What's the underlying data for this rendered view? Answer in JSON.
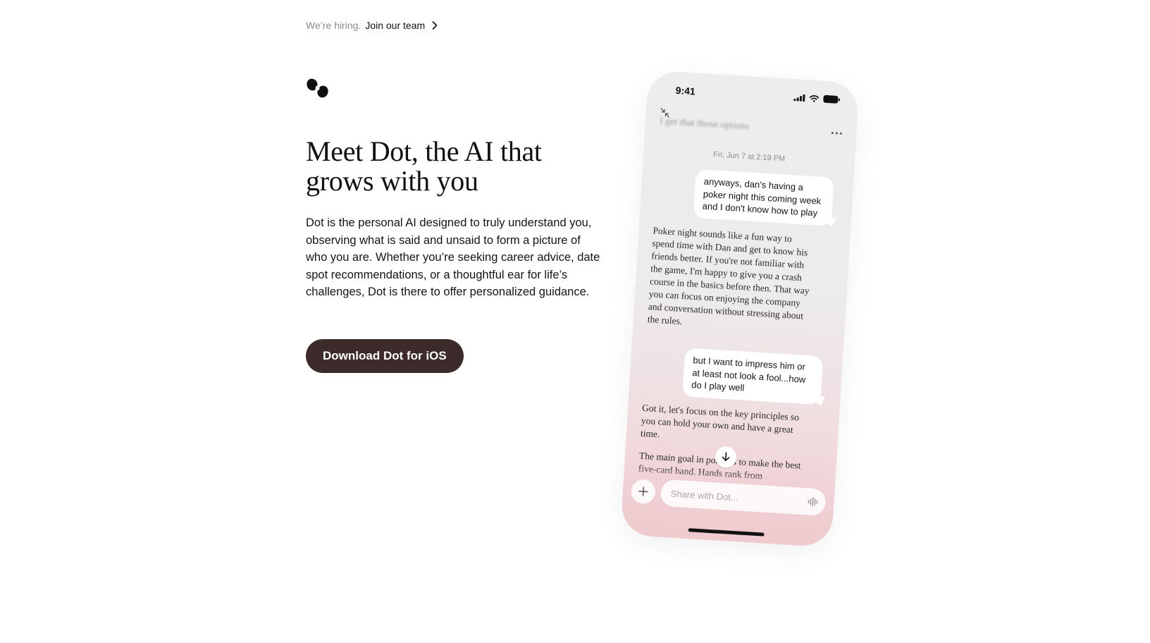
{
  "banner": {
    "prefix": "We’re hiring.",
    "link_label": "Join our team"
  },
  "hero": {
    "headline": "Meet Dot, the AI that grows with you",
    "description": "Dot is the personal AI designed to truly understand you, observing what is said and unsaid to form a picture of who you are. Whether you’re seeking career advice, date spot recommendations, or a thoughtful ear for life’s challenges, Dot is there to offer personalized guidance.",
    "cta_label": "Download Dot for iOS"
  },
  "phone": {
    "status_time": "9:41",
    "chat_title": "I get that those options",
    "timestamp": "Fri, Jun 7 at 2:19 PM",
    "messages": [
      {
        "role": "user",
        "text": "anyways, dan's having a poker night this coming week and I don't know how to play"
      },
      {
        "role": "ai",
        "text": "Poker night sounds like a fun way to spend time with Dan and get to know his friends better. If you're not familiar with the game, I'm happy to give you a crash course in the basics before then. That way you can focus on enjoying the company and conversation without stressing about the rules."
      },
      {
        "role": "user",
        "text": "but I want to impress him or at least not look a fool...how do I play well"
      },
      {
        "role": "ai",
        "text": "Got it, let's focus on the key principles so you can hold your own and have a great time."
      },
      {
        "role": "ai",
        "text": "The main goal in poker is to make the best five-card hand. Hands rank from"
      }
    ],
    "composer_placeholder": "Share with Dot..."
  },
  "colors": {
    "cta_background": "#3d2a2a",
    "phone_gradient_bottom": "#efc9cd"
  }
}
